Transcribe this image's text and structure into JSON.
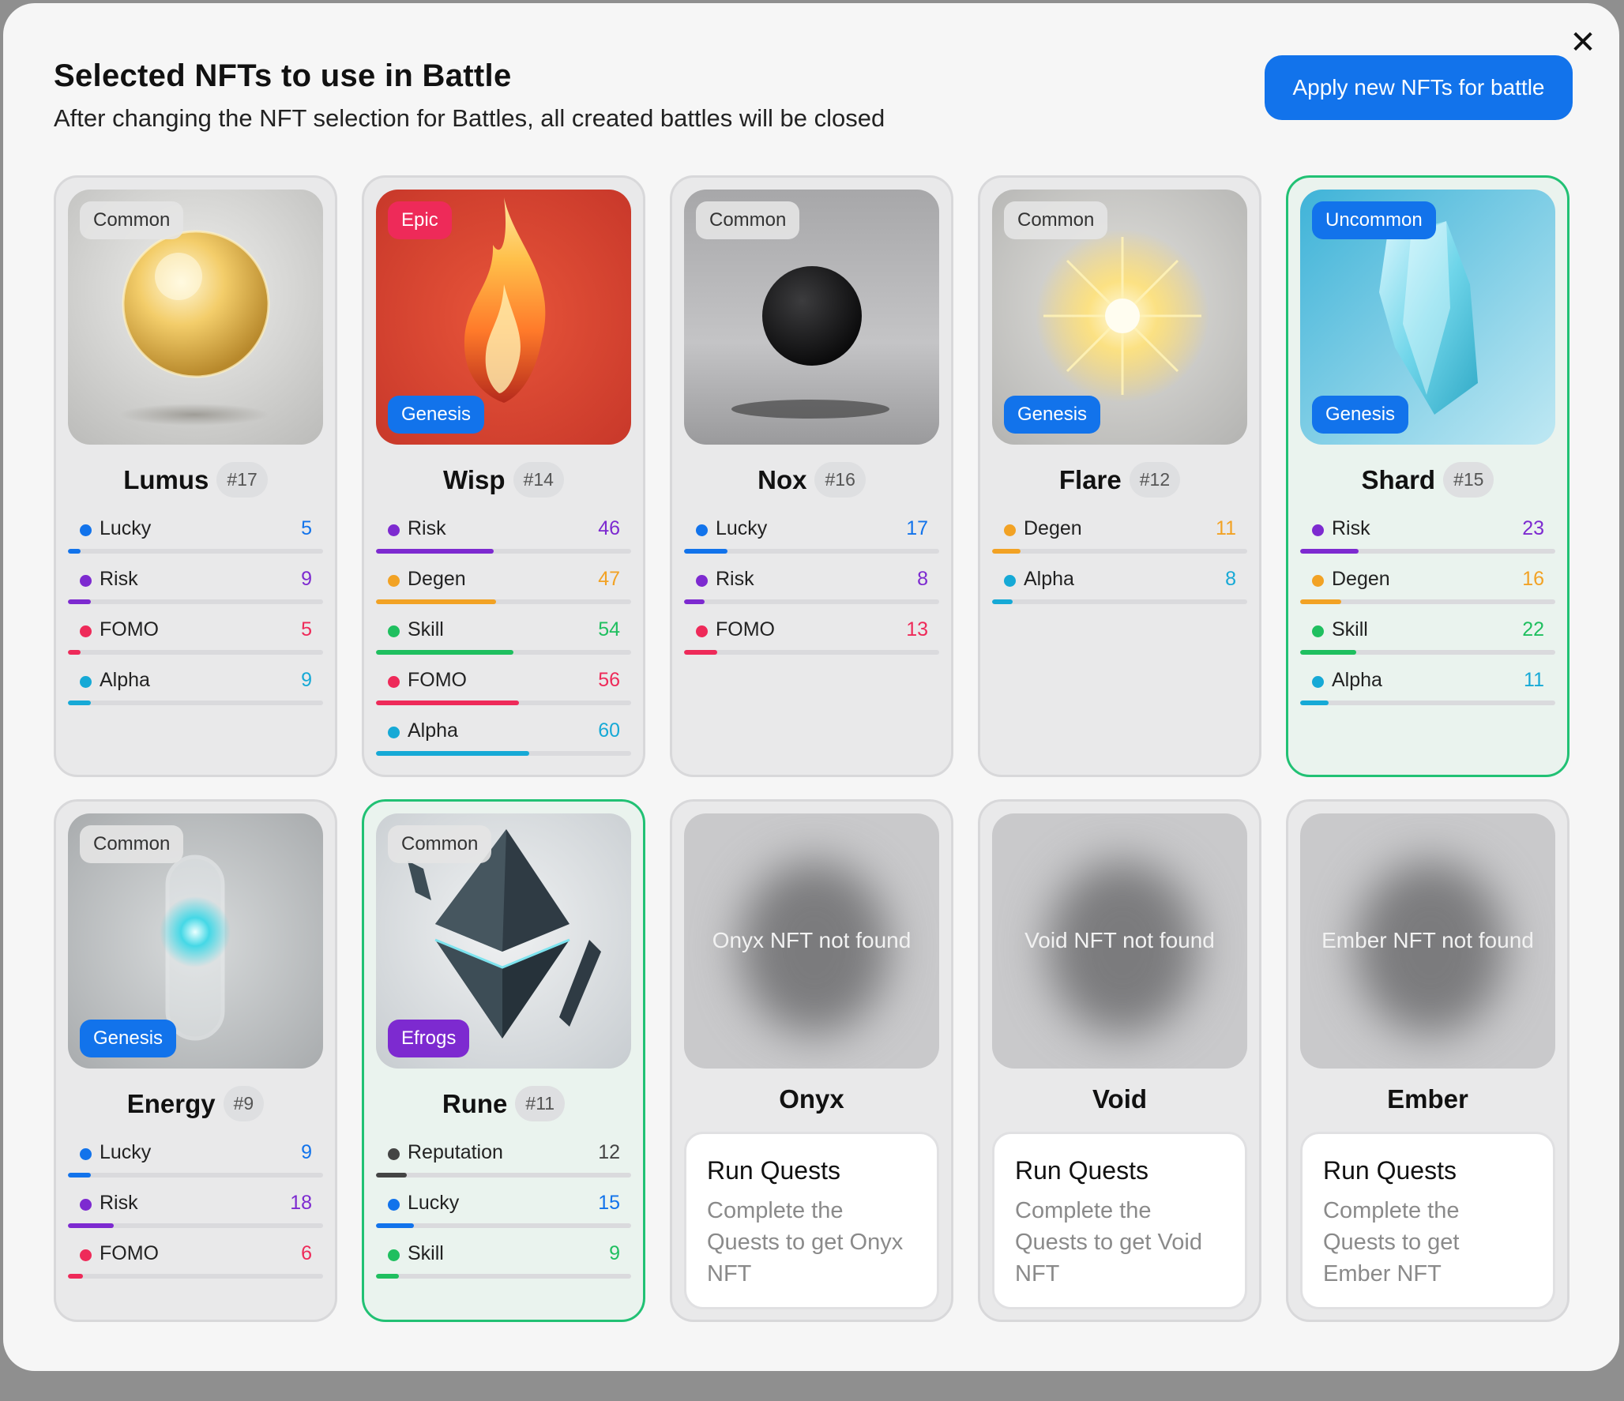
{
  "header": {
    "title": "Selected NFTs to use in Battle",
    "subtitle": "After changing the NFT selection for Battles, all created battles will be closed",
    "apply_label": "Apply new NFTs for battle",
    "close_icon": "close-icon"
  },
  "colors": {
    "Lucky": "#1273eb",
    "Risk": "#7d2ad0",
    "FOMO": "#ee2a59",
    "Alpha": "#16a9d6",
    "Degen": "#f2a224",
    "Skill": "#1fbf5f",
    "Reputation": "#444444"
  },
  "cards": [
    {
      "name": "Lumus",
      "num": "#17",
      "rarity": "Common",
      "collection": "",
      "art": "gold-orb",
      "selected": false,
      "stats": [
        {
          "label": "Lucky",
          "value": "5",
          "pct": 5
        },
        {
          "label": "Risk",
          "value": "9",
          "pct": 9
        },
        {
          "label": "FOMO",
          "value": "5",
          "pct": 5
        },
        {
          "label": "Alpha",
          "value": "9",
          "pct": 9
        }
      ]
    },
    {
      "name": "Wisp",
      "num": "#14",
      "rarity": "Epic",
      "collection": "Genesis",
      "art": "flame",
      "selected": false,
      "stats": [
        {
          "label": "Risk",
          "value": "46",
          "pct": 46
        },
        {
          "label": "Degen",
          "value": "47",
          "pct": 47
        },
        {
          "label": "Skill",
          "value": "54",
          "pct": 54
        },
        {
          "label": "FOMO",
          "value": "56",
          "pct": 56
        },
        {
          "label": "Alpha",
          "value": "60",
          "pct": 60
        }
      ]
    },
    {
      "name": "Nox",
      "num": "#16",
      "rarity": "Common",
      "collection": "",
      "art": "black-orb",
      "selected": false,
      "stats": [
        {
          "label": "Lucky",
          "value": "17",
          "pct": 17
        },
        {
          "label": "Risk",
          "value": "8",
          "pct": 8
        },
        {
          "label": "FOMO",
          "value": "13",
          "pct": 13
        }
      ]
    },
    {
      "name": "Flare",
      "num": "#12",
      "rarity": "Common",
      "collection": "Genesis",
      "art": "sparkle",
      "selected": false,
      "stats": [
        {
          "label": "Degen",
          "value": "11",
          "pct": 11
        },
        {
          "label": "Alpha",
          "value": "8",
          "pct": 8
        }
      ]
    },
    {
      "name": "Shard",
      "num": "#15",
      "rarity": "Uncommon",
      "collection": "Genesis",
      "art": "crystal",
      "selected": true,
      "stats": [
        {
          "label": "Risk",
          "value": "23",
          "pct": 23
        },
        {
          "label": "Degen",
          "value": "16",
          "pct": 16
        },
        {
          "label": "Skill",
          "value": "22",
          "pct": 22
        },
        {
          "label": "Alpha",
          "value": "11",
          "pct": 11
        }
      ]
    },
    {
      "name": "Energy",
      "num": "#9",
      "rarity": "Common",
      "collection": "Genesis",
      "art": "capsule",
      "selected": false,
      "stats": [
        {
          "label": "Lucky",
          "value": "9",
          "pct": 9
        },
        {
          "label": "Risk",
          "value": "18",
          "pct": 18
        },
        {
          "label": "FOMO",
          "value": "6",
          "pct": 6
        }
      ]
    },
    {
      "name": "Rune",
      "num": "#11",
      "rarity": "Common",
      "collection": "Efrogs",
      "art": "diamond",
      "selected": true,
      "stats": [
        {
          "label": "Reputation",
          "value": "12",
          "pct": 12
        },
        {
          "label": "Lucky",
          "value": "15",
          "pct": 15
        },
        {
          "label": "Skill",
          "value": "9",
          "pct": 9
        }
      ]
    },
    {
      "name": "Onyx",
      "locked": true,
      "not_found": "Onyx NFT not found",
      "quest_title": "Run Quests",
      "quest_desc": "Complete the Quests to get Onyx NFT"
    },
    {
      "name": "Void",
      "locked": true,
      "not_found": "Void NFT not found",
      "quest_title": "Run Quests",
      "quest_desc": "Complete the Quests to get Void NFT"
    },
    {
      "name": "Ember",
      "locked": true,
      "not_found": "Ember NFT not found",
      "quest_title": "Run Quests",
      "quest_desc": "Complete the Quests to get Ember NFT"
    }
  ]
}
